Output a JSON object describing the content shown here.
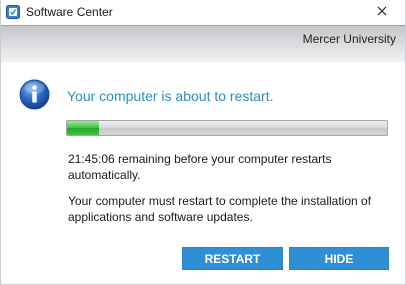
{
  "window": {
    "title": "Software Center",
    "app_icon": "software-center-icon",
    "close_icon": "close-icon"
  },
  "banner": {
    "organization": "Mercer University"
  },
  "message": {
    "icon": "info-icon",
    "heading": "Your computer is about to restart.",
    "remaining_text": "21:45:06 remaining before your computer restarts automatically.",
    "explanation": "Your computer must restart to complete the installation of applications and software updates."
  },
  "progress": {
    "fraction": 0.1
  },
  "buttons": {
    "restart_label": "RESTART",
    "hide_label": "HIDE"
  },
  "colors": {
    "heading": "#2f8bc8",
    "button_bg": "#2f8fd6",
    "progress_fill": "#3cc23c"
  }
}
